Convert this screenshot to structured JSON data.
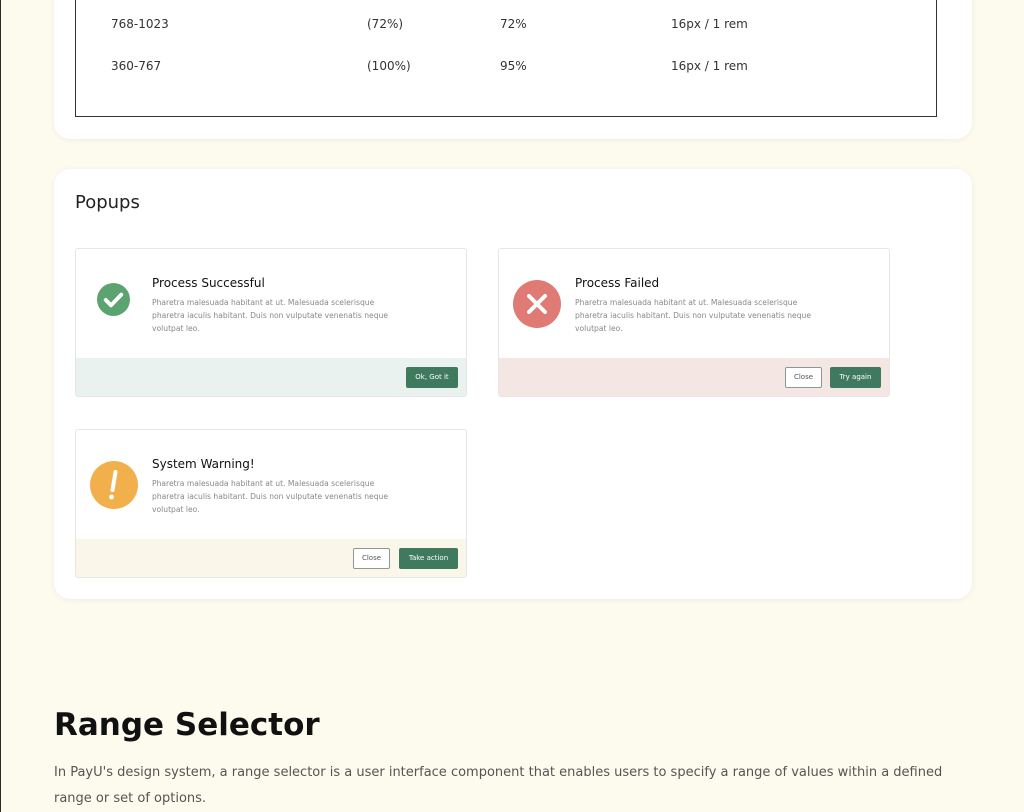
{
  "table": {
    "rows": [
      {
        "range": "768-1023",
        "width": "(72%)",
        "content": "72%",
        "font": "16px / 1 rem"
      },
      {
        "range": "360-767",
        "width": "(100%)",
        "content": "95%",
        "font": "16px / 1 rem"
      }
    ]
  },
  "popups_section": {
    "title": "Popups",
    "success": {
      "title": "Process Successful",
      "body": "Pharetra malesuada habitant at ut. Malesuada scelerisque pharetra iaculis habitant. Duis non vulputate venenatis neque volutpat leo.",
      "primary_label": "Ok, Got it",
      "icon": "check-circle-icon",
      "accent": "#5ba46f",
      "footer_bg": "#e9f2ef"
    },
    "failed": {
      "title": "Process Failed",
      "body": "Pharetra malesuada habitant at ut. Malesuada scelerisque pharetra iaculis habitant. Duis non vulputate venenatis neque volutpat leo.",
      "secondary_label": "Close",
      "primary_label": "Try again",
      "icon": "x-circle-icon",
      "accent": "#e07a74",
      "footer_bg": "#f3e6e3"
    },
    "warning": {
      "title": "System Warning!",
      "body": "Pharetra malesuada habitant at ut. Malesuada scelerisque pharetra iaculis habitant. Duis non vulputate venenatis neque volutpat leo.",
      "secondary_label": "Close",
      "primary_label": "Take action",
      "icon": "exclamation-circle-icon",
      "accent": "#f2b04d",
      "footer_bg": "#faf6ea"
    },
    "button_color": "#3f7a5f"
  },
  "range_selector": {
    "title": "Range Selector",
    "description": "In PayU's design system, a range selector is a user interface component that enables users to specify a range of values within a defined range or set of options."
  }
}
